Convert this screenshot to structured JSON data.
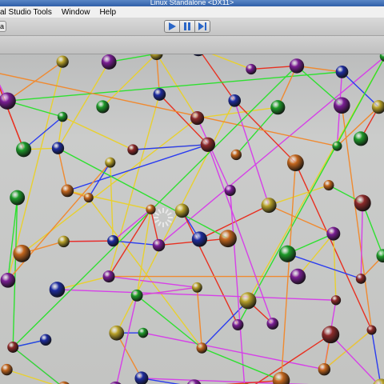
{
  "window": {
    "title": "Linux Standalone <DX11>"
  },
  "menu": {
    "items": [
      "al Studio Tools",
      "Window",
      "Help"
    ]
  },
  "toolbar": {
    "left_button": "a"
  },
  "play_controls": [
    {
      "name": "play-button",
      "icon": "play-icon",
      "active": true
    },
    {
      "name": "pause-button",
      "icon": "pause-icon",
      "active": false
    },
    {
      "name": "step-button",
      "icon": "step-icon",
      "active": false
    }
  ],
  "colors": {
    "accent": "#2a66c7",
    "scene_background": "#c8cac8",
    "node_palette": [
      "#8c2a2a",
      "#1e9a2a",
      "#1e2c9e",
      "#7a1e94",
      "#b8a22a",
      "#c2661e"
    ],
    "link_palette": [
      "#e83020",
      "#2ee030",
      "#2a3cf0",
      "#d640e8",
      "#e8d030",
      "#f08a30"
    ]
  }
}
